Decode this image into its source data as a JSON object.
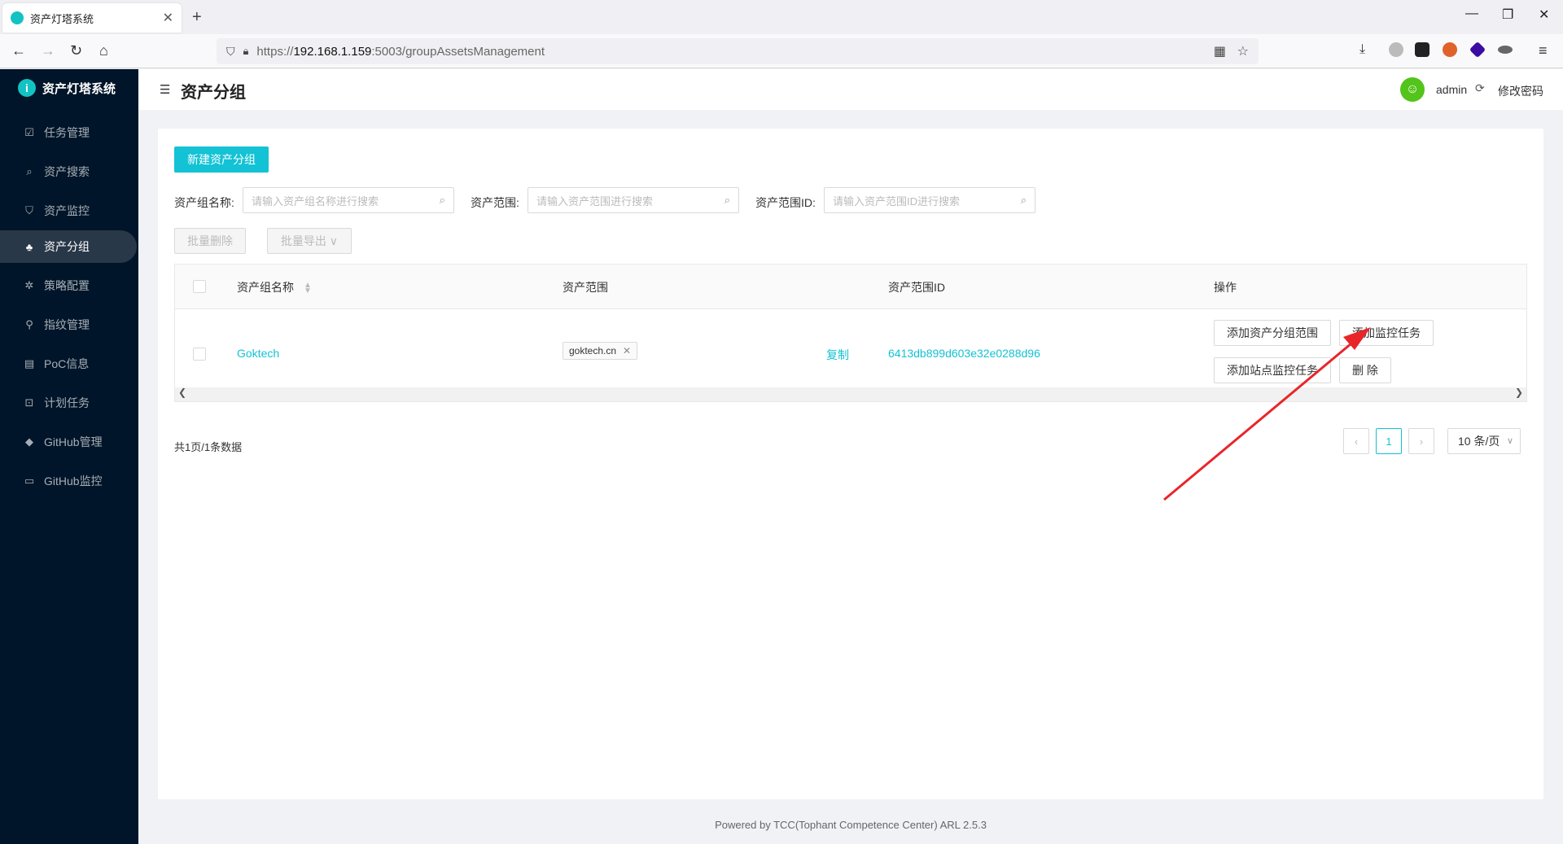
{
  "browser": {
    "tab_title": "资产灯塔系统",
    "tab_close": "✕",
    "new_tab": "+",
    "url_prefix": "https://",
    "url_host": "192.168.1.159",
    "url_rest": ":5003/groupAssetsManagement"
  },
  "sidebar": {
    "logo_text": "资产灯塔系统",
    "items": [
      {
        "label": "任务管理",
        "icon": "task-icon"
      },
      {
        "label": "资产搜索",
        "icon": "search-icon"
      },
      {
        "label": "资产监控",
        "icon": "monitor-icon"
      },
      {
        "label": "资产分组",
        "icon": "group-icon"
      },
      {
        "label": "策略配置",
        "icon": "policy-icon"
      },
      {
        "label": "指纹管理",
        "icon": "fingerprint-icon"
      },
      {
        "label": "PoC信息",
        "icon": "poc-icon"
      },
      {
        "label": "计划任务",
        "icon": "schedule-icon"
      },
      {
        "label": "GitHub管理",
        "icon": "github-icon"
      },
      {
        "label": "GitHub监控",
        "icon": "github-monitor-icon"
      }
    ],
    "active_index": 3
  },
  "header": {
    "title": "资产分组",
    "username": "admin",
    "change_password": "修改密码"
  },
  "toolbar": {
    "new_group": "新建资产分组",
    "filter_name_label": "资产组名称:",
    "filter_name_placeholder": "请输入资产组名称进行搜索",
    "filter_scope_label": "资产范围:",
    "filter_scope_placeholder": "请输入资产范围进行搜索",
    "filter_scope_id_label": "资产范围ID:",
    "filter_scope_id_placeholder": "请输入资产范围ID进行搜索",
    "batch_delete": "批量删除",
    "batch_export": "批量导出 ∨"
  },
  "table": {
    "columns": [
      "资产组名称",
      "资产范围",
      "资产范围ID",
      "操作"
    ],
    "rows": [
      {
        "name": "Goktech",
        "scope_tag": "goktech.cn",
        "copy": "复制",
        "scope_id": "6413db899d603e32e0288d96",
        "actions": [
          "添加资产分组范围",
          "添加监控任务",
          "添加站点监控任务",
          "删 除"
        ]
      }
    ]
  },
  "pagination": {
    "total_text": "共1页/1条数据",
    "current_page": "1",
    "page_size": "10 条/页"
  },
  "footer": "Powered by TCC(Tophant Competence Center) ARL 2.5.3",
  "colors": {
    "accent": "#13c2d4",
    "sidebar_bg": "#001529",
    "annotation_arrow": "#e8262a"
  }
}
